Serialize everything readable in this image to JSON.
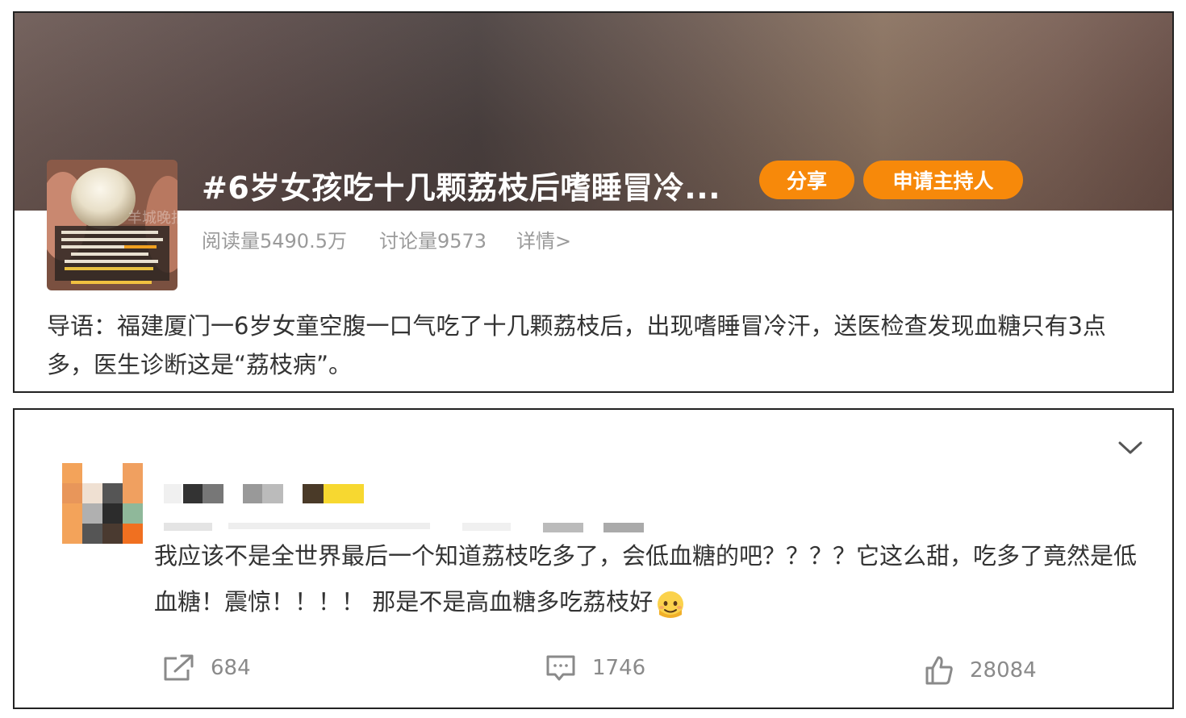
{
  "topic": {
    "title": "#6岁女孩吃十几颗荔枝后嗜睡冒冷...",
    "share_label": "分享",
    "host_label": "申请主持人",
    "reads": "阅读量5490.5万",
    "discussions": "讨论量9573",
    "details_link": "详情>",
    "intro": "导语：福建厦门一6岁女童空腹一口气吃了十几颗荔枝后，出现嗜睡冒冷汗，送医检查发现血糖只有3点多，医生诊断这是“荔枝病”。",
    "thumbnail_watermark": "羊城晚报"
  },
  "comment": {
    "text": "我应该不是全世界最后一个知道荔枝吃多了，会低血糖的吧？？？？它这么甜，吃多了竟然是低血糖！震惊！！！！ 那是不是高血糖多吃荔枝好",
    "emoji_icon": "hot-face-emoji-icon",
    "reposts": "684",
    "comments": "1746",
    "likes": "28084"
  },
  "colors": {
    "accent": "#f7890a",
    "muted_text": "#9a9a9a",
    "border": "#222222"
  }
}
